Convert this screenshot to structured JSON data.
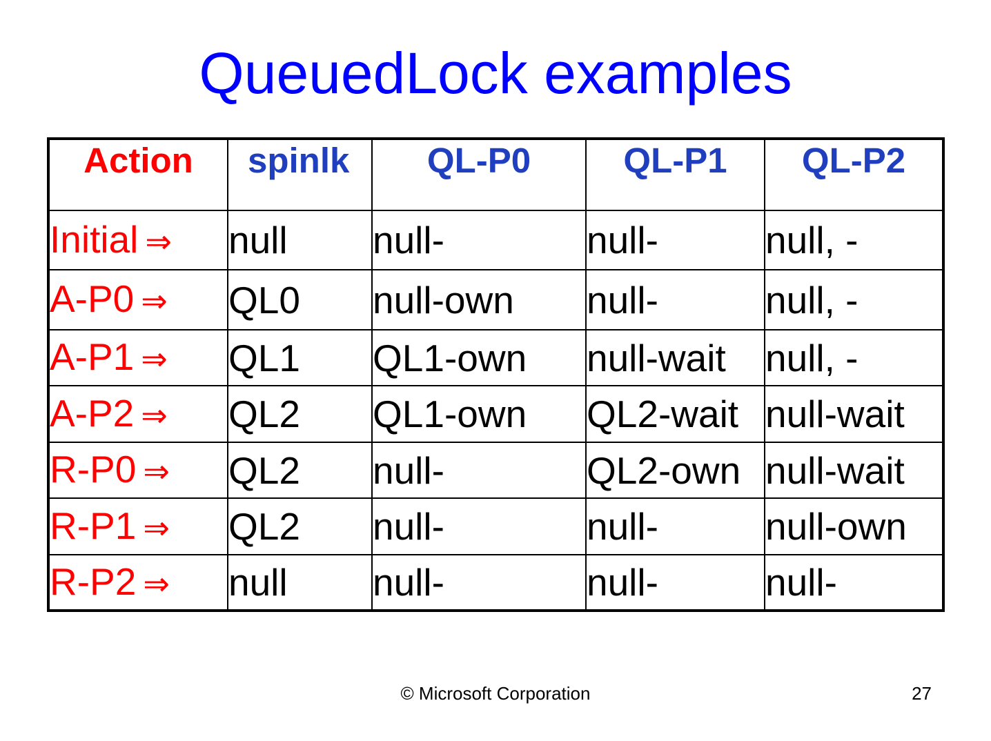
{
  "slide": {
    "title": "QueuedLock examples",
    "footer": "© Microsoft Corporation",
    "page_number": "27"
  },
  "colors": {
    "title": "#0000ff",
    "header_blue": "#1f3fbf",
    "action_red": "#ff0000",
    "text": "#000000"
  },
  "table": {
    "headers": [
      "Action",
      "spinlk",
      "QL-P0",
      "QL-P1",
      "QL-P2"
    ],
    "arrow_symbol": "⇒",
    "rows": [
      {
        "action": "Initial",
        "cells": [
          "null",
          "null-",
          "null-",
          "null, -"
        ]
      },
      {
        "action": "A-P0",
        "cells": [
          "QL0",
          "null-own",
          "null-",
          "null, -"
        ]
      },
      {
        "action": "A-P1",
        "cells": [
          "QL1",
          "QL1-own",
          "null-wait",
          "null, -"
        ]
      },
      {
        "action": "A-P2",
        "cells": [
          "QL2",
          "QL1-own",
          "QL2-wait",
          "null-wait"
        ]
      },
      {
        "action": "R-P0",
        "cells": [
          "QL2",
          "null-",
          "QL2-own",
          "null-wait"
        ]
      },
      {
        "action": "R-P1",
        "cells": [
          "QL2",
          "null-",
          "null-",
          "null-own"
        ]
      },
      {
        "action": "R-P2",
        "cells": [
          "null",
          "null-",
          "null-",
          "null-"
        ]
      }
    ]
  }
}
